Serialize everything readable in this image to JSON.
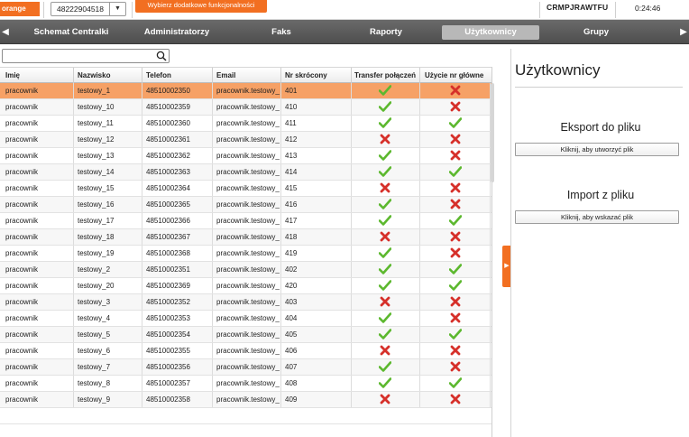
{
  "topbar": {
    "logo_text": "orange",
    "number": "48222904518",
    "extra_button": "Wybierz dodatkowe funkcjonalności",
    "account": "CRMPJRAWTFU",
    "clock": "0:24:46"
  },
  "nav": {
    "tabs": [
      {
        "label": "Schemat Centralki",
        "active": false
      },
      {
        "label": "Administratorzy",
        "active": false
      },
      {
        "label": "Faks",
        "active": false
      },
      {
        "label": "Raporty",
        "active": false
      },
      {
        "label": "Użytkownicy",
        "active": true
      },
      {
        "label": "Grupy",
        "active": false
      }
    ]
  },
  "search": {
    "value": "",
    "placeholder": ""
  },
  "table": {
    "headers": {
      "imie": "Imię",
      "nazwisko": "Nazwisko",
      "telefon": "Telefon",
      "email": "Email",
      "nr_skrocony": "Nr skrócony",
      "transfer": "Transfer połączeń",
      "uzycie": "Użycie nr główne"
    },
    "rows": [
      {
        "imie": "pracownik",
        "nazwisko": "testowy_1",
        "telefon": "48510002350",
        "email": "pracownik.testowy_",
        "nr": "401",
        "transfer": true,
        "uzycie": false,
        "selected": true
      },
      {
        "imie": "pracownik",
        "nazwisko": "testowy_10",
        "telefon": "48510002359",
        "email": "pracownik.testowy_",
        "nr": "410",
        "transfer": true,
        "uzycie": false
      },
      {
        "imie": "pracownik",
        "nazwisko": "testowy_11",
        "telefon": "48510002360",
        "email": "pracownik.testowy_",
        "nr": "411",
        "transfer": true,
        "uzycie": true
      },
      {
        "imie": "pracownik",
        "nazwisko": "testowy_12",
        "telefon": "48510002361",
        "email": "pracownik.testowy_",
        "nr": "412",
        "transfer": false,
        "uzycie": false
      },
      {
        "imie": "pracownik",
        "nazwisko": "testowy_13",
        "telefon": "48510002362",
        "email": "pracownik.testowy_",
        "nr": "413",
        "transfer": true,
        "uzycie": false
      },
      {
        "imie": "pracownik",
        "nazwisko": "testowy_14",
        "telefon": "48510002363",
        "email": "pracownik.testowy_",
        "nr": "414",
        "transfer": true,
        "uzycie": true
      },
      {
        "imie": "pracownik",
        "nazwisko": "testowy_15",
        "telefon": "48510002364",
        "email": "pracownik.testowy_",
        "nr": "415",
        "transfer": false,
        "uzycie": false
      },
      {
        "imie": "pracownik",
        "nazwisko": "testowy_16",
        "telefon": "48510002365",
        "email": "pracownik.testowy_",
        "nr": "416",
        "transfer": true,
        "uzycie": false
      },
      {
        "imie": "pracownik",
        "nazwisko": "testowy_17",
        "telefon": "48510002366",
        "email": "pracownik.testowy_",
        "nr": "417",
        "transfer": true,
        "uzycie": true
      },
      {
        "imie": "pracownik",
        "nazwisko": "testowy_18",
        "telefon": "48510002367",
        "email": "pracownik.testowy_",
        "nr": "418",
        "transfer": false,
        "uzycie": false
      },
      {
        "imie": "pracownik",
        "nazwisko": "testowy_19",
        "telefon": "48510002368",
        "email": "pracownik.testowy_",
        "nr": "419",
        "transfer": true,
        "uzycie": false
      },
      {
        "imie": "pracownik",
        "nazwisko": "testowy_2",
        "telefon": "48510002351",
        "email": "pracownik.testowy_",
        "nr": "402",
        "transfer": true,
        "uzycie": true
      },
      {
        "imie": "pracownik",
        "nazwisko": "testowy_20",
        "telefon": "48510002369",
        "email": "pracownik.testowy_",
        "nr": "420",
        "transfer": true,
        "uzycie": true
      },
      {
        "imie": "pracownik",
        "nazwisko": "testowy_3",
        "telefon": "48510002352",
        "email": "pracownik.testowy_",
        "nr": "403",
        "transfer": false,
        "uzycie": false
      },
      {
        "imie": "pracownik",
        "nazwisko": "testowy_4",
        "telefon": "48510002353",
        "email": "pracownik.testowy_",
        "nr": "404",
        "transfer": true,
        "uzycie": false
      },
      {
        "imie": "pracownik",
        "nazwisko": "testowy_5",
        "telefon": "48510002354",
        "email": "pracownik.testowy_",
        "nr": "405",
        "transfer": true,
        "uzycie": true
      },
      {
        "imie": "pracownik",
        "nazwisko": "testowy_6",
        "telefon": "48510002355",
        "email": "pracownik.testowy_",
        "nr": "406",
        "transfer": false,
        "uzycie": false
      },
      {
        "imie": "pracownik",
        "nazwisko": "testowy_7",
        "telefon": "48510002356",
        "email": "pracownik.testowy_",
        "nr": "407",
        "transfer": true,
        "uzycie": false
      },
      {
        "imie": "pracownik",
        "nazwisko": "testowy_8",
        "telefon": "48510002357",
        "email": "pracownik.testowy_",
        "nr": "408",
        "transfer": true,
        "uzycie": true
      },
      {
        "imie": "pracownik",
        "nazwisko": "testowy_9",
        "telefon": "48510002358",
        "email": "pracownik.testowy_",
        "nr": "409",
        "transfer": false,
        "uzycie": false
      }
    ]
  },
  "panel": {
    "title": "Użytkownicy",
    "export_title": "Eksport do pliku",
    "export_button": "Kliknij, aby utworzyć plik",
    "import_title": "Import z pliku",
    "import_button": "Kliknij, aby wskazać plik"
  },
  "colors": {
    "accent": "#f26f21",
    "selected_row": "#f6a166",
    "check": "#5cb82e",
    "cross": "#d6302a"
  }
}
